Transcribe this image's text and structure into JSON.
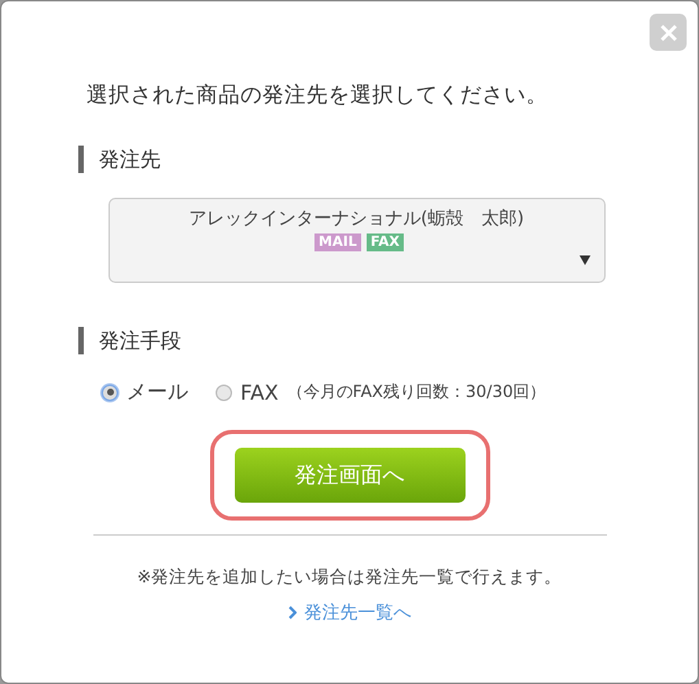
{
  "instruction": "選択された商品の発注先を選択してください。",
  "supplier_section": {
    "heading": "発注先",
    "select": {
      "value": "アレックインターナショナル(蛎殻　太郎)",
      "tags": [
        {
          "label": "MAIL",
          "color": "#cc99cc"
        },
        {
          "label": "FAX",
          "color": "#66bb88"
        }
      ]
    }
  },
  "method_section": {
    "heading": "発注手段",
    "options": [
      {
        "label": "メール",
        "selected": true
      },
      {
        "label": "FAX",
        "note": "（今月のFAX残り回数：30/30回）",
        "selected": false
      }
    ]
  },
  "submit_button": {
    "label": "発注画面へ",
    "highlighted": true
  },
  "footer": {
    "note": "※発注先を追加したい場合は発注先一覧で行えます。",
    "link": "発注先一覧へ"
  }
}
